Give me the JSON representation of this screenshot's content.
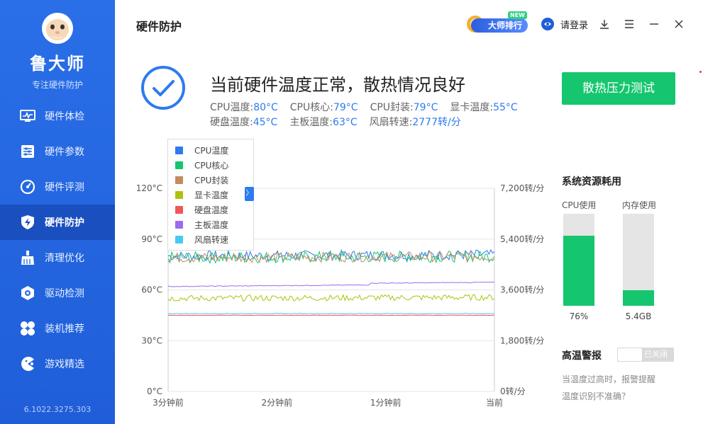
{
  "app": {
    "name": "鲁大师",
    "subtitle": "专注硬件防护",
    "version": "6.1022.3275.303"
  },
  "sidebar": {
    "items": [
      {
        "label": "硬件体检",
        "icon": "monitor-pulse-icon",
        "active": false
      },
      {
        "label": "硬件参数",
        "icon": "sliders-icon",
        "active": false
      },
      {
        "label": "硬件评测",
        "icon": "gauge-icon",
        "active": false
      },
      {
        "label": "硬件防护",
        "icon": "shield-bolt-icon",
        "active": true
      },
      {
        "label": "清理优化",
        "icon": "broom-icon",
        "active": false
      },
      {
        "label": "驱动检测",
        "icon": "hexagon-gear-icon",
        "active": false
      },
      {
        "label": "装机推荐",
        "icon": "fan-icon",
        "active": false
      },
      {
        "label": "游戏精选",
        "icon": "pacman-icon",
        "active": false
      }
    ]
  },
  "header": {
    "title": "硬件防护",
    "rank_label": "大师排行",
    "rank_badge": "NEW",
    "login_label": "请登录"
  },
  "status": {
    "title": "当前硬件温度正常，散热情况良好",
    "readings_row1": [
      {
        "label": "CPU温度:",
        "value": "80°C"
      },
      {
        "label": "CPU核心:",
        "value": "79°C"
      },
      {
        "label": "CPU封装:",
        "value": "79°C"
      },
      {
        "label": "显卡温度:",
        "value": "55°C"
      }
    ],
    "readings_row2": [
      {
        "label": "硬盘温度:",
        "value": "45°C"
      },
      {
        "label": "主板温度:",
        "value": "63°C"
      },
      {
        "label": "风扇转速:",
        "value": "2777转/分"
      }
    ],
    "stress_button": "散热压力测试"
  },
  "colors": {
    "sidebar_bg": "#2a6fe8",
    "sidebar_active": "#1a4fbf",
    "accent": "#2d7bf0",
    "green": "#16c66e"
  },
  "chart_data": {
    "type": "line",
    "y_left_ticks": [
      "0°C",
      "30°C",
      "60°C",
      "90°C",
      "120°C"
    ],
    "y_right_ticks": [
      "0转/分",
      "1,800转/分",
      "3,600转/分",
      "5,400转/分",
      "7,200转/分"
    ],
    "x_ticks": [
      "3分钟前",
      "2分钟前",
      "1分钟前",
      "当前"
    ],
    "ylim": [
      0,
      120
    ],
    "y2lim": [
      0,
      7200
    ],
    "series": [
      {
        "name": "CPU温度",
        "color": "#2d7bf0",
        "base": 80,
        "noise": 3.0,
        "trend": 0.8
      },
      {
        "name": "CPU核心",
        "color": "#16c66e",
        "base": 79,
        "noise": 3.4,
        "trend": 0.8
      },
      {
        "name": "CPU封装",
        "color": "#c58a5e",
        "base": 79,
        "noise": 3.0,
        "trend": 0.8
      },
      {
        "name": "显卡温度",
        "color": "#aec10f",
        "base": 55,
        "noise": 1.8,
        "trend": 0.6
      },
      {
        "name": "硬盘温度",
        "color": "#f05656",
        "base": 45,
        "noise": 0.1,
        "trend": 0
      },
      {
        "name": "主板温度",
        "color": "#9b6cf0",
        "base": 62,
        "noise": 0.2,
        "trend": 1.5
      },
      {
        "name": "风扇转速",
        "color": "#4bc8f0",
        "base": 46,
        "noise": 0.2,
        "trend": 0
      }
    ]
  },
  "resources": {
    "title": "系统资源耗用",
    "cpu_label": "CPU使用",
    "cpu_value": "76%",
    "cpu_fraction": 0.76,
    "mem_label": "内存使用",
    "mem_value": "5.4GB",
    "mem_fraction": 0.17
  },
  "alarm": {
    "title": "高温警报",
    "toggle_text": "已关闭",
    "note1": "当温度过高时，报警提醒",
    "note2": "温度识别不准确？"
  }
}
